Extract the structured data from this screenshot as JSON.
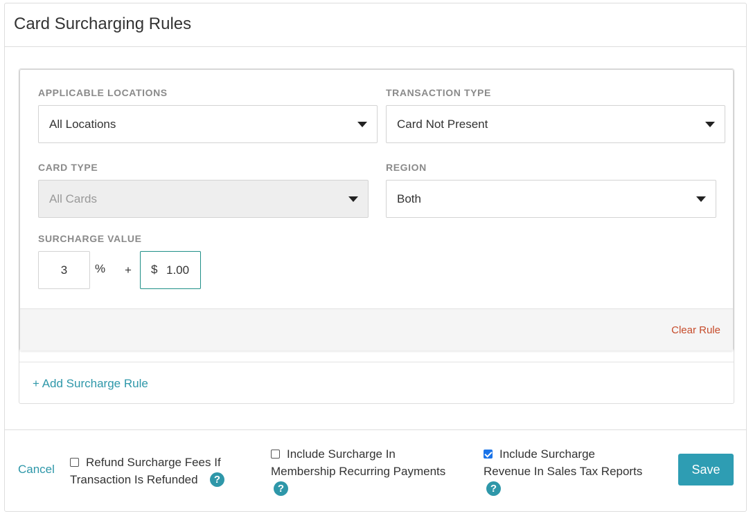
{
  "header": {
    "title": "Card Surcharging Rules"
  },
  "rule": {
    "applicable_locations": {
      "label": "APPLICABLE LOCATIONS",
      "value": "All Locations"
    },
    "transaction_type": {
      "label": "TRANSACTION TYPE",
      "value": "Card Not Present"
    },
    "card_type": {
      "label": "CARD TYPE",
      "value": "All Cards"
    },
    "region": {
      "label": "REGION",
      "value": "Both"
    },
    "surcharge": {
      "label": "SURCHARGE VALUE",
      "percent_value": "3",
      "percent_symbol": "%",
      "plus": "+",
      "currency_symbol": "$",
      "flat_value": "1.00"
    },
    "clear_label": "Clear Rule"
  },
  "add_rule_label": "+ Add Surcharge Rule",
  "footer": {
    "cancel_label": "Cancel",
    "options": [
      {
        "line1": "Refund Surcharge Fees If",
        "line2": "Transaction Is Refunded",
        "checked": false
      },
      {
        "line1": "Include Surcharge In",
        "line2": "Membership Recurring Payments",
        "checked": false
      },
      {
        "line1": "Include Surcharge",
        "line2": "Revenue In Sales Tax Reports",
        "checked": true
      }
    ],
    "help_glyph": "?",
    "save_label": "Save"
  },
  "colors": {
    "accent": "#2e97a9",
    "save_button": "#2e9db3",
    "clear_rule": "#c64b2a",
    "checkbox_checked": "#1a73e8"
  },
  "icons": [
    "chevron-down-icon",
    "help-icon",
    "checkbox-icon"
  ]
}
